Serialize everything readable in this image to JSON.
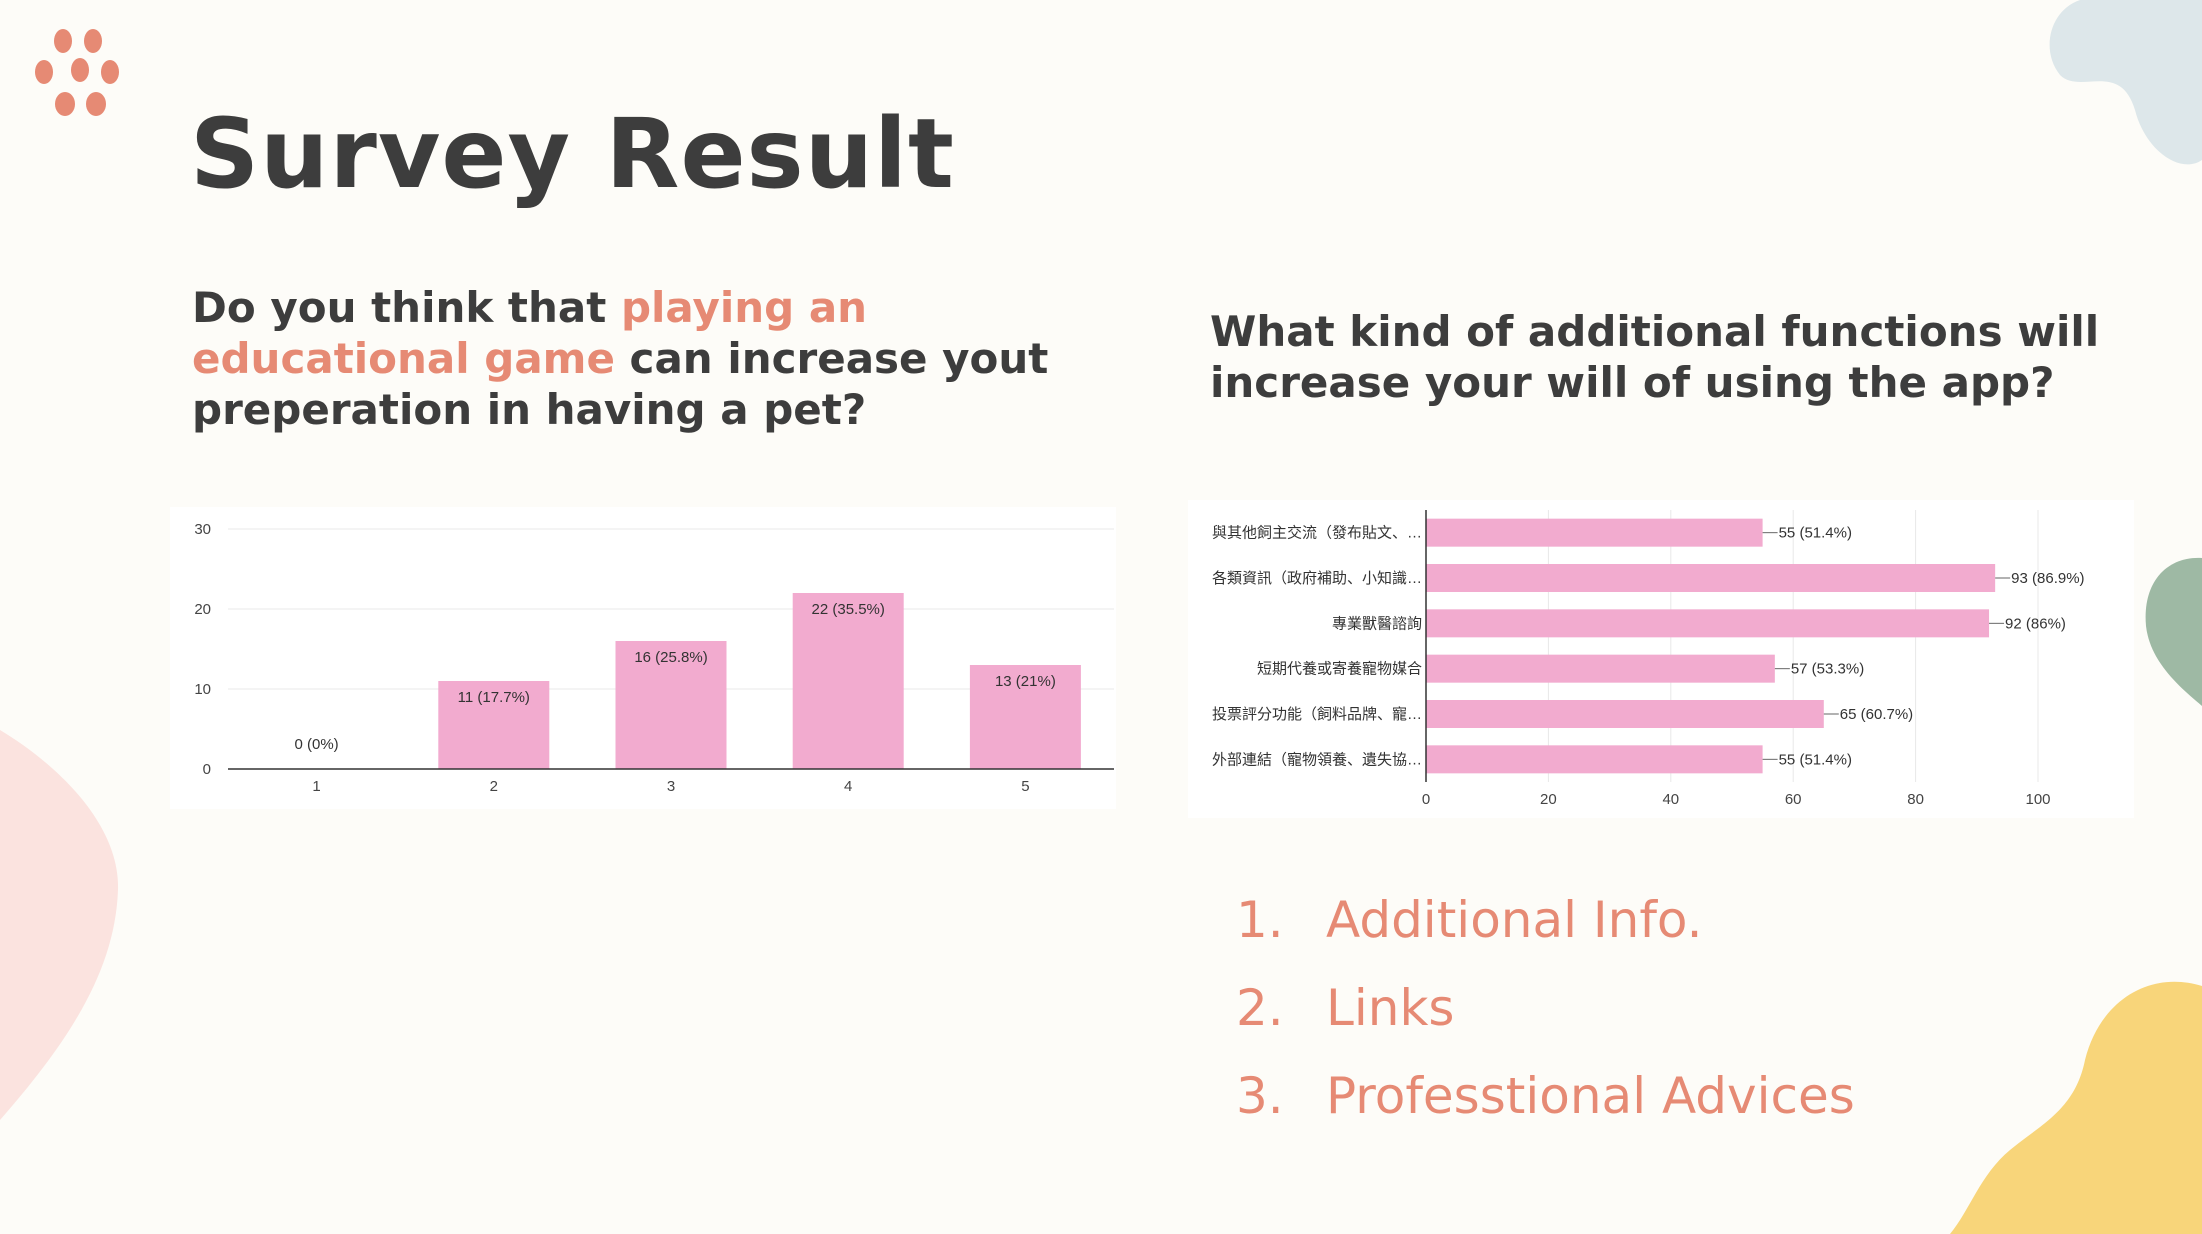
{
  "slide": {
    "title": "Survey Result",
    "paw_icon": "paw-icon",
    "colors": {
      "accent": "#e68a74",
      "text": "#3d3d3d",
      "bar": "#f2abcf",
      "background": "#fdfcf8"
    }
  },
  "left": {
    "question_part1": "Do you think that ",
    "question_highlight": "playing an educational game",
    "question_part2": " can increase yout preperation in having a pet?"
  },
  "right": {
    "question": "What kind of additional functions will increase your will of using the app?",
    "items": [
      {
        "num": "1.",
        "label": "Additional Info."
      },
      {
        "num": "2.",
        "label": "Links"
      },
      {
        "num": "3.",
        "label": "Professtional Advices"
      }
    ]
  },
  "chart_data": [
    {
      "type": "bar",
      "categories": [
        "1",
        "2",
        "3",
        "4",
        "5"
      ],
      "values": [
        0,
        11,
        16,
        22,
        13
      ],
      "data_labels": [
        "0 (0%)",
        "11 (17.7%)",
        "16 (25.8%)",
        "22 (35.5%)",
        "13 (21%)"
      ],
      "ylim": [
        0,
        30
      ],
      "yticks": [
        0,
        10,
        20,
        30
      ],
      "grid": true
    },
    {
      "type": "bar",
      "orientation": "horizontal",
      "categories": [
        "與其他飼主交流（發布貼文、…",
        "各類資訊（政府補助、小知識…",
        "專業獸醫諮詢",
        "短期代養或寄養寵物媒合",
        "投票評分功能（飼料品牌、寵…",
        "外部連結（寵物領養、遺失協…"
      ],
      "values": [
        55,
        93,
        92,
        57,
        65,
        55
      ],
      "data_labels": [
        "55 (51.4%)",
        "93 (86.9%)",
        "92 (86%)",
        "57 (53.3%)",
        "65 (60.7%)",
        "55 (51.4%)"
      ],
      "xlim": [
        0,
        100
      ],
      "xticks": [
        0,
        20,
        40,
        60,
        80,
        100
      ],
      "grid": true
    }
  ]
}
